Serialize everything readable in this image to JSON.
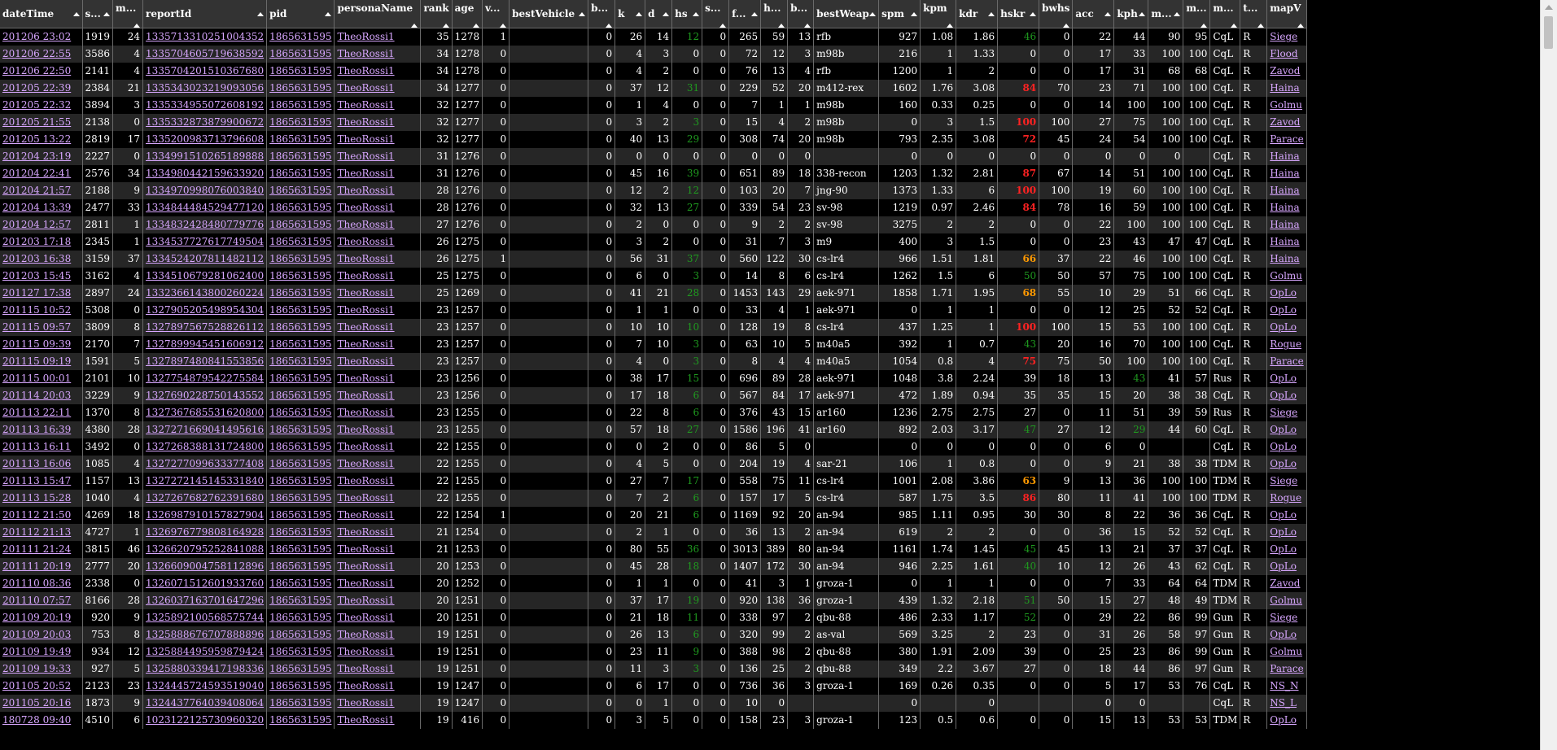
{
  "columns": [
    "dateTime",
    "s...",
    "m...",
    "reportId",
    "pid",
    "personaName",
    "rank",
    "age",
    "v...",
    "bestVehicle",
    "b...",
    "k",
    "d",
    "hs",
    "s...",
    "f...",
    "h...",
    "b...",
    "bestWeap",
    "spm",
    "kpm",
    "kdr",
    "hskr",
    "bwhs",
    "acc",
    "kph",
    "m...",
    "m...",
    "m...",
    "t...",
    "mapV"
  ],
  "rows": [
    [
      "201206 23:02",
      "1919",
      "24",
      "1335713310251004352",
      "1865631595",
      "TheoRossi1",
      "35",
      "1278",
      "1",
      "",
      "0",
      "26",
      "14",
      "12",
      "0",
      "265",
      "59",
      "13",
      "rfb",
      "927",
      "1.08",
      "1.86",
      "46",
      "0",
      "22",
      "44",
      "90",
      "95",
      "CqL",
      "R",
      "Siege"
    ],
    [
      "201206 22:55",
      "3586",
      "4",
      "1335704605719638592",
      "1865631595",
      "TheoRossi1",
      "34",
      "1278",
      "0",
      "",
      "0",
      "4",
      "3",
      "0",
      "0",
      "72",
      "12",
      "3",
      "m98b",
      "216",
      "1",
      "1.33",
      "0",
      "0",
      "17",
      "33",
      "100",
      "100",
      "CqL",
      "R",
      "Flood"
    ],
    [
      "201206 22:50",
      "2141",
      "4",
      "1335704201510367680",
      "1865631595",
      "TheoRossi1",
      "34",
      "1278",
      "0",
      "",
      "0",
      "4",
      "2",
      "0",
      "0",
      "76",
      "13",
      "4",
      "rfb",
      "1200",
      "1",
      "2",
      "0",
      "0",
      "17",
      "31",
      "68",
      "68",
      "CqL",
      "R",
      "Zavod"
    ],
    [
      "201205 22:39",
      "2384",
      "21",
      "1335343023219093056",
      "1865631595",
      "TheoRossi1",
      "34",
      "1277",
      "0",
      "",
      "0",
      "37",
      "12",
      "31",
      "0",
      "229",
      "52",
      "20",
      "m412-rex",
      "1602",
      "1.76",
      "3.08",
      "84",
      "70",
      "23",
      "71",
      "100",
      "100",
      "CqL",
      "R",
      "Haina"
    ],
    [
      "201205 22:32",
      "3894",
      "3",
      "1335334955072608192",
      "1865631595",
      "TheoRossi1",
      "32",
      "1277",
      "0",
      "",
      "0",
      "1",
      "4",
      "0",
      "0",
      "7",
      "1",
      "1",
      "m98b",
      "160",
      "0.33",
      "0.25",
      "0",
      "0",
      "14",
      "100",
      "100",
      "100",
      "CqL",
      "R",
      "Golmu"
    ],
    [
      "201205 21:55",
      "2138",
      "0",
      "1335332873879900672",
      "1865631595",
      "TheoRossi1",
      "32",
      "1277",
      "0",
      "",
      "0",
      "3",
      "2",
      "3",
      "0",
      "15",
      "4",
      "2",
      "m98b",
      "0",
      "3",
      "1.5",
      "100",
      "100",
      "27",
      "75",
      "100",
      "100",
      "CqL",
      "R",
      "Zavod"
    ],
    [
      "201205 13:22",
      "2819",
      "17",
      "1335200983713796608",
      "1865631595",
      "TheoRossi1",
      "32",
      "1277",
      "0",
      "",
      "0",
      "40",
      "13",
      "29",
      "0",
      "308",
      "74",
      "20",
      "m98b",
      "793",
      "2.35",
      "3.08",
      "72",
      "45",
      "24",
      "54",
      "100",
      "100",
      "CqL",
      "R",
      "Parace"
    ],
    [
      "201204 23:19",
      "2227",
      "0",
      "1334991510265189888",
      "1865631595",
      "TheoRossi1",
      "31",
      "1276",
      "0",
      "",
      "0",
      "0",
      "0",
      "0",
      "0",
      "0",
      "0",
      "0",
      "",
      "0",
      "0",
      "0",
      "0",
      "0",
      "0",
      "0",
      "0",
      "",
      "CqL",
      "R",
      "Haina"
    ],
    [
      "201204 22:41",
      "2576",
      "34",
      "1334980442159633920",
      "1865631595",
      "TheoRossi1",
      "31",
      "1276",
      "0",
      "",
      "0",
      "45",
      "16",
      "39",
      "0",
      "651",
      "89",
      "18",
      "338-recon",
      "1203",
      "1.32",
      "2.81",
      "87",
      "67",
      "14",
      "51",
      "100",
      "100",
      "CqL",
      "R",
      "Haina"
    ],
    [
      "201204 21:57",
      "2188",
      "9",
      "1334970998076003840",
      "1865631595",
      "TheoRossi1",
      "28",
      "1276",
      "0",
      "",
      "0",
      "12",
      "2",
      "12",
      "0",
      "103",
      "20",
      "7",
      "jng-90",
      "1373",
      "1.33",
      "6",
      "100",
      "100",
      "19",
      "60",
      "100",
      "100",
      "CqL",
      "R",
      "Haina"
    ],
    [
      "201204 13:39",
      "2477",
      "33",
      "1334844484529477120",
      "1865631595",
      "TheoRossi1",
      "28",
      "1276",
      "0",
      "",
      "0",
      "32",
      "13",
      "27",
      "0",
      "339",
      "54",
      "23",
      "sv-98",
      "1219",
      "0.97",
      "2.46",
      "84",
      "78",
      "16",
      "59",
      "100",
      "100",
      "CqL",
      "R",
      "Haina"
    ],
    [
      "201204 12:57",
      "2811",
      "1",
      "1334832428480779776",
      "1865631595",
      "TheoRossi1",
      "27",
      "1276",
      "0",
      "",
      "0",
      "2",
      "0",
      "0",
      "0",
      "9",
      "2",
      "2",
      "sv-98",
      "3275",
      "2",
      "2",
      "0",
      "0",
      "22",
      "100",
      "100",
      "100",
      "CqL",
      "R",
      "Haina"
    ],
    [
      "201203 17:18",
      "2345",
      "1",
      "1334537727617749504",
      "1865631595",
      "TheoRossi1",
      "26",
      "1275",
      "0",
      "",
      "0",
      "3",
      "2",
      "0",
      "0",
      "31",
      "7",
      "3",
      "m9",
      "400",
      "3",
      "1.5",
      "0",
      "0",
      "23",
      "43",
      "47",
      "47",
      "CqL",
      "R",
      "Haina"
    ],
    [
      "201203 16:38",
      "3159",
      "37",
      "1334524207811482112",
      "1865631595",
      "TheoRossi1",
      "26",
      "1275",
      "1",
      "",
      "0",
      "56",
      "31",
      "37",
      "0",
      "560",
      "122",
      "30",
      "cs-lr4",
      "966",
      "1.51",
      "1.81",
      "66",
      "37",
      "22",
      "46",
      "100",
      "100",
      "CqL",
      "R",
      "Haina"
    ],
    [
      "201203 15:45",
      "3162",
      "4",
      "1334510679281062400",
      "1865631595",
      "TheoRossi1",
      "25",
      "1275",
      "0",
      "",
      "0",
      "6",
      "0",
      "3",
      "0",
      "14",
      "8",
      "6",
      "cs-lr4",
      "1262",
      "1.5",
      "6",
      "50",
      "50",
      "57",
      "75",
      "100",
      "100",
      "CqL",
      "R",
      "Golmu"
    ],
    [
      "201127 17:38",
      "2897",
      "24",
      "1332366143800260224",
      "1865631595",
      "TheoRossi1",
      "25",
      "1269",
      "0",
      "",
      "0",
      "41",
      "21",
      "28",
      "0",
      "1453",
      "143",
      "29",
      "aek-971",
      "1858",
      "1.71",
      "1.95",
      "68",
      "55",
      "10",
      "29",
      "51",
      "66",
      "CqL",
      "R",
      "OpLo"
    ],
    [
      "201115 10:52",
      "5308",
      "0",
      "1327905205498954304",
      "1865631595",
      "TheoRossi1",
      "23",
      "1257",
      "0",
      "",
      "0",
      "1",
      "1",
      "0",
      "0",
      "33",
      "4",
      "1",
      "aek-971",
      "0",
      "1",
      "1",
      "0",
      "0",
      "12",
      "25",
      "52",
      "52",
      "CqL",
      "R",
      "OpLo"
    ],
    [
      "201115 09:57",
      "3809",
      "8",
      "1327897567528826112",
      "1865631595",
      "TheoRossi1",
      "23",
      "1257",
      "0",
      "",
      "0",
      "10",
      "10",
      "10",
      "0",
      "128",
      "19",
      "8",
      "cs-lr4",
      "437",
      "1.25",
      "1",
      "100",
      "100",
      "15",
      "53",
      "100",
      "100",
      "CqL",
      "R",
      "OpLo"
    ],
    [
      "201115 09:39",
      "2170",
      "7",
      "1327899945451606912",
      "1865631595",
      "TheoRossi1",
      "23",
      "1257",
      "0",
      "",
      "0",
      "7",
      "10",
      "3",
      "0",
      "63",
      "10",
      "5",
      "m40a5",
      "392",
      "1",
      "0.7",
      "43",
      "20",
      "16",
      "70",
      "100",
      "100",
      "CqL",
      "R",
      "Rogue"
    ],
    [
      "201115 09:19",
      "1591",
      "5",
      "1327897480841553856",
      "1865631595",
      "TheoRossi1",
      "23",
      "1257",
      "0",
      "",
      "0",
      "4",
      "0",
      "3",
      "0",
      "8",
      "4",
      "4",
      "m40a5",
      "1054",
      "0.8",
      "4",
      "75",
      "75",
      "50",
      "100",
      "100",
      "100",
      "CqL",
      "R",
      "Parace"
    ],
    [
      "201115 00:01",
      "2101",
      "10",
      "1327754879542275584",
      "1865631595",
      "TheoRossi1",
      "23",
      "1256",
      "0",
      "",
      "0",
      "38",
      "17",
      "15",
      "0",
      "696",
      "89",
      "28",
      "aek-971",
      "1048",
      "3.8",
      "2.24",
      "39",
      "18",
      "13",
      "43",
      "41",
      "57",
      "Rus",
      "R",
      "OpLo"
    ],
    [
      "201114 20:03",
      "3229",
      "9",
      "1327690228750143552",
      "1865631595",
      "TheoRossi1",
      "23",
      "1256",
      "0",
      "",
      "0",
      "17",
      "18",
      "6",
      "0",
      "567",
      "84",
      "17",
      "aek-971",
      "472",
      "1.89",
      "0.94",
      "35",
      "35",
      "15",
      "20",
      "38",
      "38",
      "CqL",
      "R",
      "OpLo"
    ],
    [
      "201113 22:11",
      "1370",
      "8",
      "1327367685531620800",
      "1865631595",
      "TheoRossi1",
      "23",
      "1255",
      "0",
      "",
      "0",
      "22",
      "8",
      "6",
      "0",
      "376",
      "43",
      "15",
      "ar160",
      "1236",
      "2.75",
      "2.75",
      "27",
      "0",
      "11",
      "51",
      "39",
      "59",
      "Rus",
      "R",
      "Siege"
    ],
    [
      "201113 16:39",
      "4380",
      "28",
      "1327271669041495616",
      "1865631595",
      "TheoRossi1",
      "23",
      "1255",
      "0",
      "",
      "0",
      "57",
      "18",
      "27",
      "0",
      "1586",
      "196",
      "41",
      "ar160",
      "892",
      "2.03",
      "3.17",
      "47",
      "27",
      "12",
      "29",
      "44",
      "60",
      "CqL",
      "R",
      "OpLo"
    ],
    [
      "201113 16:11",
      "3492",
      "0",
      "1327268388131724800",
      "1865631595",
      "TheoRossi1",
      "22",
      "1255",
      "0",
      "",
      "0",
      "0",
      "2",
      "0",
      "0",
      "86",
      "5",
      "0",
      "",
      "0",
      "0",
      "0",
      "0",
      "0",
      "6",
      "0",
      "",
      "",
      "CqL",
      "R",
      "OpLo"
    ],
    [
      "201113 16:06",
      "1085",
      "4",
      "1327277099633377408",
      "1865631595",
      "TheoRossi1",
      "22",
      "1255",
      "0",
      "",
      "0",
      "4",
      "5",
      "0",
      "0",
      "204",
      "19",
      "4",
      "sar-21",
      "106",
      "1",
      "0.8",
      "0",
      "0",
      "9",
      "21",
      "38",
      "38",
      "TDM",
      "R",
      "OpLo"
    ],
    [
      "201113 15:47",
      "1157",
      "13",
      "1327272145145331840",
      "1865631595",
      "TheoRossi1",
      "22",
      "1255",
      "0",
      "",
      "0",
      "27",
      "7",
      "17",
      "0",
      "558",
      "75",
      "11",
      "cs-lr4",
      "1001",
      "2.08",
      "3.86",
      "63",
      "9",
      "13",
      "36",
      "100",
      "100",
      "TDM",
      "R",
      "Siege"
    ],
    [
      "201113 15:28",
      "1040",
      "4",
      "1327267682762391680",
      "1865631595",
      "TheoRossi1",
      "22",
      "1255",
      "0",
      "",
      "0",
      "7",
      "2",
      "6",
      "0",
      "157",
      "17",
      "5",
      "cs-lr4",
      "587",
      "1.75",
      "3.5",
      "86",
      "80",
      "11",
      "41",
      "100",
      "100",
      "TDM",
      "R",
      "Rogue"
    ],
    [
      "201112 21:50",
      "4269",
      "18",
      "1326987910157827904",
      "1865631595",
      "TheoRossi1",
      "22",
      "1254",
      "1",
      "",
      "0",
      "20",
      "21",
      "6",
      "0",
      "1169",
      "92",
      "20",
      "an-94",
      "985",
      "1.11",
      "0.95",
      "30",
      "30",
      "8",
      "22",
      "36",
      "36",
      "CqL",
      "R",
      "OpLo"
    ],
    [
      "201112 21:13",
      "4727",
      "1",
      "1326976779808164928",
      "1865631595",
      "TheoRossi1",
      "21",
      "1254",
      "0",
      "",
      "0",
      "2",
      "1",
      "0",
      "0",
      "36",
      "13",
      "2",
      "an-94",
      "619",
      "2",
      "2",
      "0",
      "0",
      "36",
      "15",
      "52",
      "52",
      "CqL",
      "R",
      "OpLo"
    ],
    [
      "201111 21:24",
      "3815",
      "46",
      "1326620795252841088",
      "1865631595",
      "TheoRossi1",
      "21",
      "1253",
      "0",
      "",
      "0",
      "80",
      "55",
      "36",
      "0",
      "3013",
      "389",
      "80",
      "an-94",
      "1161",
      "1.74",
      "1.45",
      "45",
      "45",
      "13",
      "21",
      "37",
      "37",
      "CqL",
      "R",
      "OpLo"
    ],
    [
      "201111 20:19",
      "2777",
      "20",
      "1326609004758112896",
      "1865631595",
      "TheoRossi1",
      "20",
      "1253",
      "0",
      "",
      "0",
      "45",
      "28",
      "18",
      "0",
      "1407",
      "172",
      "30",
      "an-94",
      "946",
      "2.25",
      "1.61",
      "40",
      "10",
      "12",
      "26",
      "43",
      "62",
      "CqL",
      "R",
      "OpLo"
    ],
    [
      "201110 08:36",
      "2338",
      "0",
      "1326071512601933760",
      "1865631595",
      "TheoRossi1",
      "20",
      "1252",
      "0",
      "",
      "0",
      "1",
      "1",
      "0",
      "0",
      "41",
      "3",
      "1",
      "groza-1",
      "0",
      "1",
      "1",
      "0",
      "0",
      "7",
      "33",
      "64",
      "64",
      "TDM",
      "R",
      "Zavod"
    ],
    [
      "201110 07:57",
      "8166",
      "28",
      "1326037163701647296",
      "1865631595",
      "TheoRossi1",
      "20",
      "1251",
      "0",
      "",
      "0",
      "37",
      "17",
      "19",
      "0",
      "920",
      "138",
      "36",
      "groza-1",
      "439",
      "1.32",
      "2.18",
      "51",
      "50",
      "15",
      "27",
      "48",
      "49",
      "TDM",
      "R",
      "Golmu"
    ],
    [
      "201109 20:19",
      "920",
      "9",
      "1325892100568575744",
      "1865631595",
      "TheoRossi1",
      "20",
      "1251",
      "0",
      "",
      "0",
      "21",
      "18",
      "11",
      "0",
      "338",
      "97",
      "2",
      "qbu-88",
      "486",
      "2.33",
      "1.17",
      "52",
      "0",
      "29",
      "22",
      "86",
      "99",
      "Gun",
      "R",
      "Siege"
    ],
    [
      "201109 20:03",
      "753",
      "8",
      "1325888676707888896",
      "1865631595",
      "TheoRossi1",
      "19",
      "1251",
      "0",
      "",
      "0",
      "26",
      "13",
      "6",
      "0",
      "320",
      "99",
      "2",
      "as-val",
      "569",
      "3.25",
      "2",
      "23",
      "0",
      "31",
      "26",
      "58",
      "97",
      "Gun",
      "R",
      "OpLo"
    ],
    [
      "201109 19:49",
      "934",
      "12",
      "1325884495959879424",
      "1865631595",
      "TheoRossi1",
      "19",
      "1251",
      "0",
      "",
      "0",
      "23",
      "11",
      "9",
      "0",
      "388",
      "98",
      "2",
      "qbu-88",
      "380",
      "1.91",
      "2.09",
      "39",
      "0",
      "25",
      "23",
      "86",
      "99",
      "Gun",
      "R",
      "Golmu"
    ],
    [
      "201109 19:33",
      "927",
      "5",
      "1325880339417198336",
      "1865631595",
      "TheoRossi1",
      "19",
      "1251",
      "0",
      "",
      "0",
      "11",
      "3",
      "3",
      "0",
      "136",
      "25",
      "2",
      "qbu-88",
      "349",
      "2.2",
      "3.67",
      "27",
      "0",
      "18",
      "44",
      "86",
      "97",
      "Gun",
      "R",
      "Parace"
    ],
    [
      "201105 20:52",
      "2123",
      "23",
      "1324445724593519040",
      "1865631595",
      "TheoRossi1",
      "19",
      "1247",
      "0",
      "",
      "0",
      "6",
      "17",
      "0",
      "0",
      "736",
      "36",
      "3",
      "groza-1",
      "169",
      "0.26",
      "0.35",
      "0",
      "0",
      "5",
      "17",
      "53",
      "76",
      "CqL",
      "R",
      "NS_N"
    ],
    [
      "201105 20:16",
      "1873",
      "9",
      "1324437764039408064",
      "1865631595",
      "TheoRossi1",
      "19",
      "1247",
      "0",
      "",
      "0",
      "0",
      "1",
      "0",
      "0",
      "10",
      "0",
      "",
      "",
      "0",
      "",
      "0",
      "",
      "",
      "0",
      "0",
      "",
      "",
      "CqL",
      "R",
      "NS_L"
    ],
    [
      "180728 09:40",
      "4510",
      "6",
      "1023122125730960320",
      "1865631595",
      "TheoRossi1",
      "19",
      "416",
      "0",
      "",
      "0",
      "3",
      "5",
      "0",
      "0",
      "158",
      "23",
      "3",
      "groza-1",
      "123",
      "0.5",
      "0.6",
      "0",
      "0",
      "15",
      "13",
      "53",
      "53",
      "TDM",
      "R",
      "OpLo"
    ]
  ],
  "hskr_colors": {
    "46": "green",
    "84": "red",
    "100": "red",
    "72": "red",
    "87": "red",
    "66": "orange",
    "50": "green",
    "68": "orange",
    "43": "green",
    "75": "red",
    "47": "green",
    "63": "orange",
    "86": "red",
    "45": "green",
    "40": "green",
    "51": "green",
    "52": "green"
  },
  "acc_green_rows": [
    20,
    23
  ],
  "scrollbar": "vertical-scrollbar"
}
